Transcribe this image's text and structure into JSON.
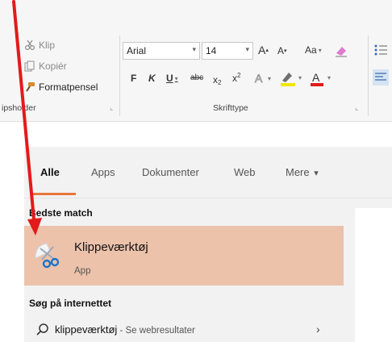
{
  "top_fragment": "aa",
  "ribbon": {
    "clipboard": {
      "cut_label": "Klip",
      "copy_label": "Kopiér",
      "painter_label": "Formatpensel",
      "group_label": "ipsholder"
    },
    "font": {
      "font_name": "Arial",
      "font_size": "14",
      "grow_label": "A",
      "shrink_label": "A",
      "case_label": "Aa",
      "bold": "F",
      "italic": "K",
      "underline": "U",
      "strike": "abc",
      "subscript": "x",
      "superscript": "x",
      "group_label": "Skrifttype"
    },
    "launcher_glyph": "⌞"
  },
  "search": {
    "tabs": [
      {
        "label": "Alle",
        "active": true
      },
      {
        "label": "Apps"
      },
      {
        "label": "Dokumenter"
      },
      {
        "label": "Web"
      },
      {
        "label": "Mere"
      }
    ],
    "more_arrow": "▾",
    "best_match_header": "Bedste match",
    "best_match": {
      "title": "Klippeværktøj",
      "subtitle": "App"
    },
    "web_header": "Søg på internettet",
    "web_result": {
      "query": "klippeværktøj",
      "suffix": " - Se webresultater",
      "chevron": "›"
    }
  },
  "colors": {
    "accent": "#e8763c",
    "best_match_bg": "#ecc2ab",
    "arrow": "#e31a1a"
  }
}
